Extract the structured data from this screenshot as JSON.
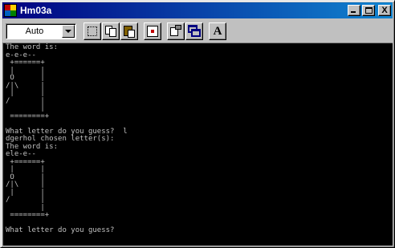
{
  "window": {
    "title": "Hm03a",
    "icon": "msdos-icon",
    "controls": {
      "minimize_icon": "minimize-icon",
      "maximize_icon": "maximize-icon",
      "close_icon": "close-icon",
      "close_glyph": "X"
    }
  },
  "toolbar": {
    "font_size": "Auto",
    "buttons": [
      {
        "name": "mark-button",
        "icon": "mark-icon"
      },
      {
        "name": "copy-button",
        "icon": "copy-icon"
      },
      {
        "name": "paste-button",
        "icon": "paste-icon"
      },
      {
        "name": "full-screen-button",
        "icon": "full-screen-icon"
      },
      {
        "name": "properties-button",
        "icon": "properties-icon"
      },
      {
        "name": "background-button",
        "icon": "background-icon"
      },
      {
        "name": "font-button",
        "icon": "font-icon",
        "label": "A"
      }
    ]
  },
  "console": {
    "lines": [
      "The word is:",
      "e-e-e--",
      " +======+",
      " |      |",
      " O      |",
      "/|\\     |",
      " |      |",
      "/       |",
      "        |",
      " ========+",
      "",
      "What letter do you guess?  l",
      "dgerhol chosen letter(s):",
      "The word is:",
      "ele-e--",
      " +======+",
      " |      |",
      " O      |",
      "/|\\     |",
      " |      |",
      "/       |",
      "        |",
      " ========+",
      "",
      "What letter do you guess?"
    ]
  },
  "colors": {
    "title_gradient_start": "#000080",
    "title_gradient_end": "#1084d0",
    "console_bg": "#000000",
    "console_fg": "#c0c0c0",
    "chrome": "#c0c0c0"
  }
}
